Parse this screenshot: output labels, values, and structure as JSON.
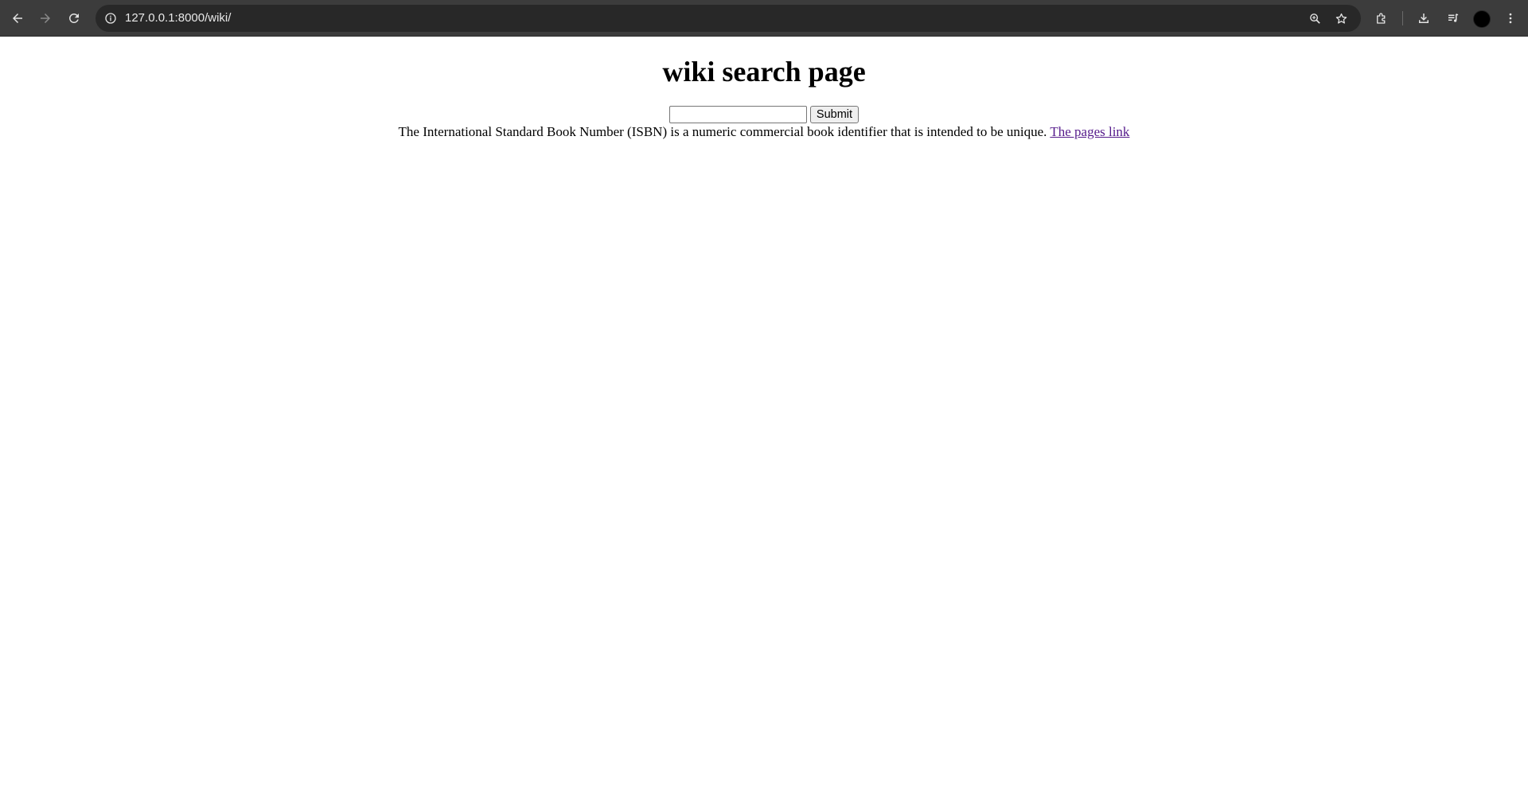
{
  "browser": {
    "url": "127.0.0.1:8000/wiki/",
    "icons": {
      "back": "arrow-left-icon",
      "forward": "arrow-right-icon",
      "reload": "reload-icon",
      "site_info": "info-icon",
      "zoom": "zoom-icon",
      "bookmark": "star-icon",
      "extensions": "puzzle-icon",
      "downloads": "download-icon",
      "media": "media-queue-icon",
      "profile": "avatar",
      "menu": "kebab-menu-icon"
    },
    "colors": {
      "toolbar": "#3c3c3c",
      "omnibox": "#282828",
      "url_text": "#e8e8e8"
    }
  },
  "page": {
    "title": "wiki search page",
    "search": {
      "value": "",
      "placeholder": ""
    },
    "submit_label": "Submit",
    "description": "The International Standard Book Number (ISBN) is a numeric commercial book identifier that is intended to be unique.",
    "link_text": "The pages link",
    "link_color": "#551a8b"
  }
}
